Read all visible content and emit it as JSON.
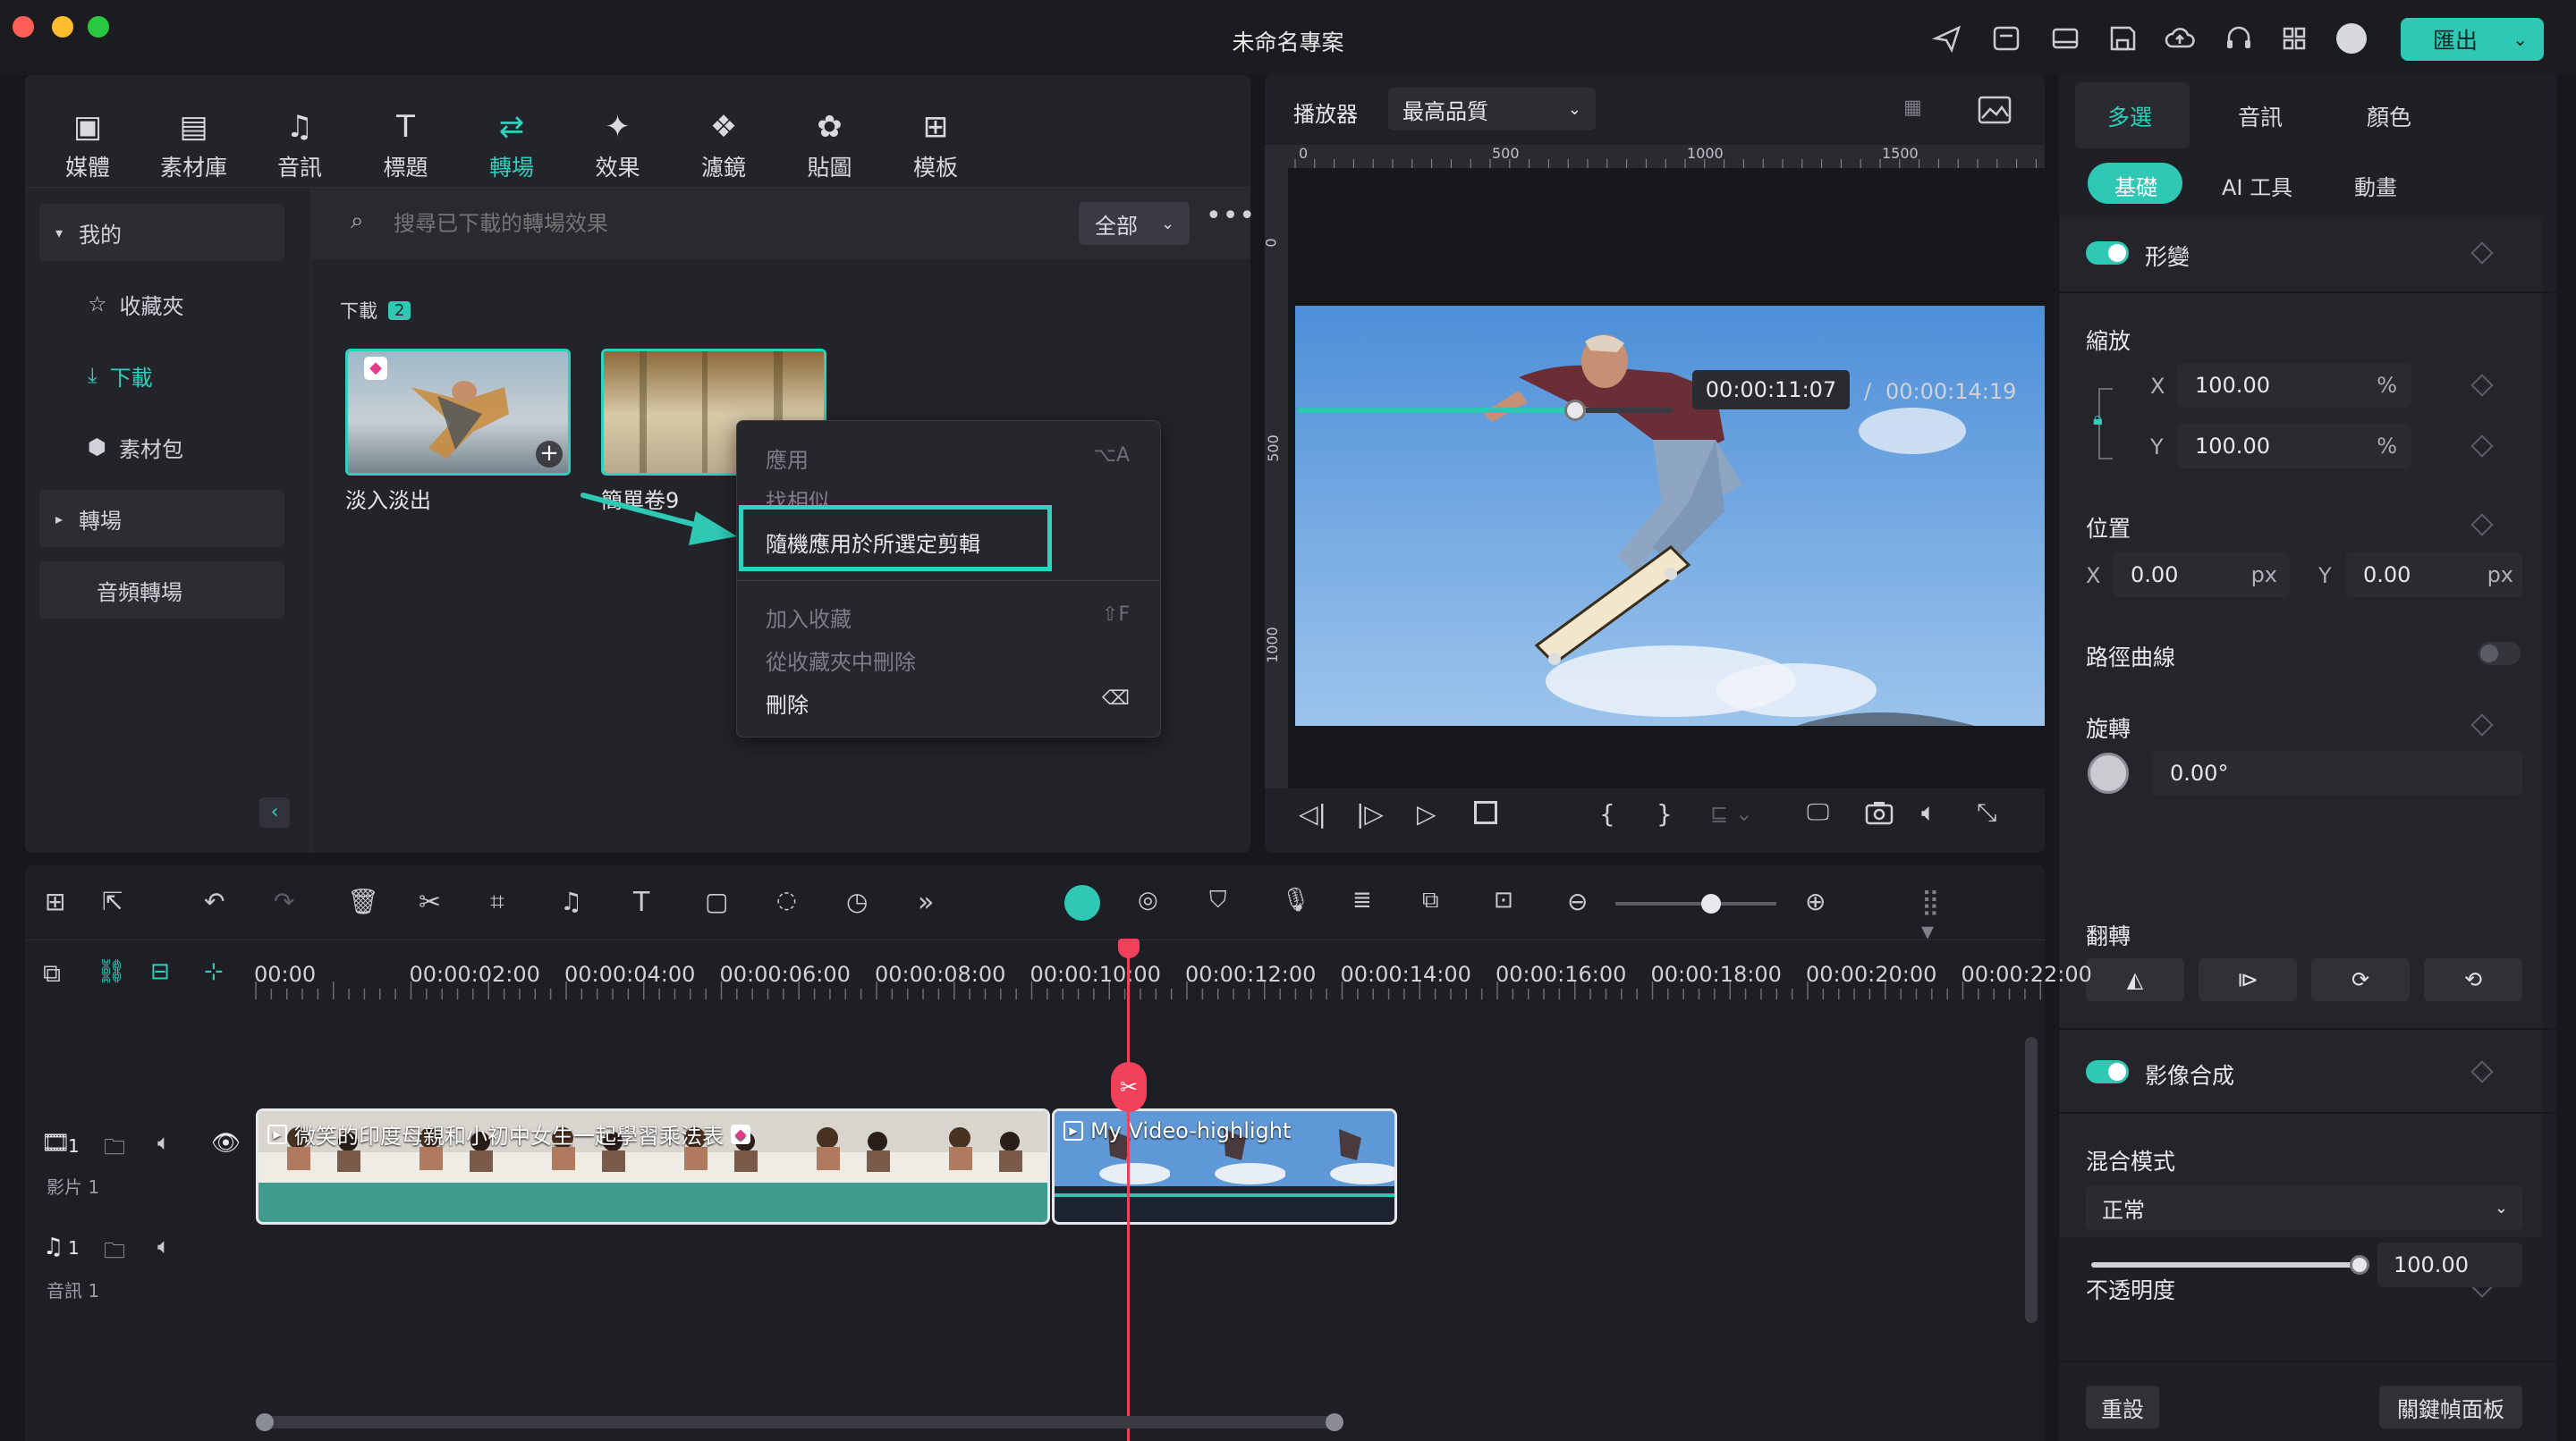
{
  "window": {
    "title": "未命名專案",
    "export_label": "匯出"
  },
  "library": {
    "tabs": [
      {
        "label": "媒體",
        "icon": "media-icon"
      },
      {
        "label": "素材庫",
        "icon": "stock-icon"
      },
      {
        "label": "音訊",
        "icon": "music-note-icon"
      },
      {
        "label": "標題",
        "icon": "title-t-icon"
      },
      {
        "label": "轉場",
        "icon": "transition-icon",
        "active": true
      },
      {
        "label": "效果",
        "icon": "effects-star-icon"
      },
      {
        "label": "濾鏡",
        "icon": "filter-icon"
      },
      {
        "label": "貼圖",
        "icon": "sticker-icon"
      },
      {
        "label": "模板",
        "icon": "template-icon"
      }
    ],
    "sidebar": {
      "mine": "我的",
      "favorites": "收藏夾",
      "downloads": "下載",
      "packs": "素材包",
      "transitions": "轉場",
      "audio_transitions": "音頻轉場"
    },
    "search_placeholder": "搜尋已下載的轉場效果",
    "filter": "全部",
    "section_label": "下載",
    "section_count": "2",
    "items": [
      {
        "label": "淡入淡出"
      },
      {
        "label": "簡單卷9"
      }
    ]
  },
  "context_menu": {
    "apply": "應用",
    "apply_shortcut": "⌥A",
    "find_similar": "找相似",
    "random_apply": "隨機應用於所選定剪輯",
    "add_fav": "加入收藏",
    "add_fav_shortcut": "⇧F",
    "remove_fav": "從收藏夾中刪除",
    "delete": "刪除"
  },
  "player": {
    "label": "播放器",
    "quality": "最高品質",
    "ruler": [
      "0",
      "500",
      "1000",
      "1500"
    ],
    "vruler": [
      "0",
      "500",
      "1000"
    ],
    "current": "00:00:11:07",
    "separator": "/",
    "total": "00:00:14:19",
    "progress": 0.74
  },
  "properties": {
    "tabs": [
      "多選",
      "音訊",
      "顏色"
    ],
    "subtabs": [
      "基礎",
      "AI 工具",
      "動畫"
    ],
    "transform": "形變",
    "scale": "縮放",
    "x_label": "X",
    "y_label": "Y",
    "scale_x": "100.00",
    "scale_y": "100.00",
    "percent": "%",
    "position": "位置",
    "pos_x": "0.00",
    "pos_y": "0.00",
    "px": "px",
    "path_curve": "路徑曲線",
    "rotate": "旋轉",
    "rotate_value": "0.00°",
    "flip": "翻轉",
    "compositing": "影像合成",
    "blend_mode": "混合模式",
    "blend_value": "正常",
    "opacity": "不透明度",
    "opacity_value": "100.00",
    "opacity_level": 1.0,
    "reset": "重設",
    "keyframe_panel": "關鍵幀面板"
  },
  "timeline": {
    "ruler": [
      "00:00",
      "00:00:02:00",
      "00:00:04:00",
      "00:00:06:00",
      "00:00:08:00",
      "00:00:10:00",
      "00:00:12:00",
      "00:00:14:00",
      "00:00:16:00",
      "00:00:18:00",
      "00:00:20:00",
      "00:00:22:00"
    ],
    "video_track": "影片 1",
    "audio_track": "音訊 1",
    "track_num": "1",
    "clips": [
      {
        "title": "微笑的印度母親和小初中女生一起學習乘法表"
      },
      {
        "title": "My Video-highlight"
      }
    ]
  },
  "colors": {
    "accent": "#2fc8b4",
    "playhead": "#f0405a"
  }
}
